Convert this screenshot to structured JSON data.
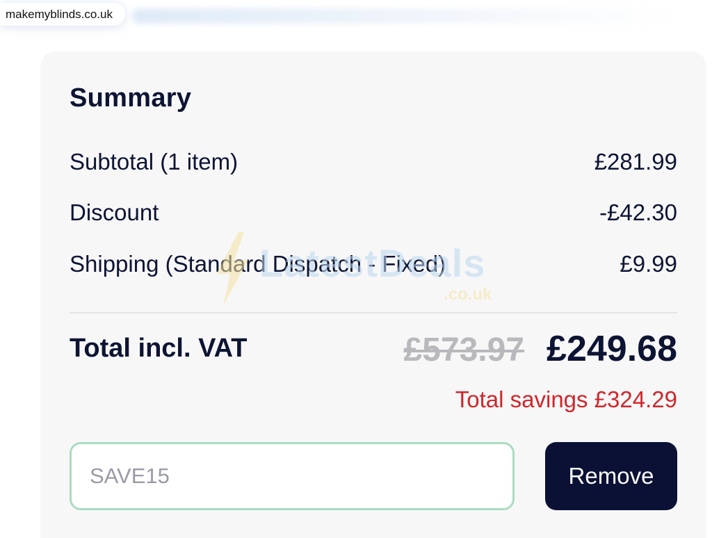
{
  "browser": {
    "site_domain": "makemyblinds.co.uk"
  },
  "summary": {
    "title": "Summary",
    "lines": [
      {
        "label": "Subtotal (1 item)",
        "value": "£281.99"
      },
      {
        "label": "Discount",
        "value": "-£42.30"
      },
      {
        "label": "Shipping (Standard Dispatch - Fixed)",
        "value": "£9.99"
      }
    ],
    "total_label": "Total incl. VAT",
    "original_total": "£573.97",
    "total": "£249.68",
    "savings": "Total savings £324.29"
  },
  "voucher": {
    "code": "SAVE15",
    "remove_label": "Remove"
  },
  "watermark": {
    "text": "LatestDeals",
    "subtext": ".co.uk"
  },
  "colors": {
    "primary": "#0b1135",
    "savings": "#d1262a",
    "strikethrough": "#b9b9bd",
    "input_border": "#a9dcc0",
    "card_bg": "#f7f7f8"
  }
}
